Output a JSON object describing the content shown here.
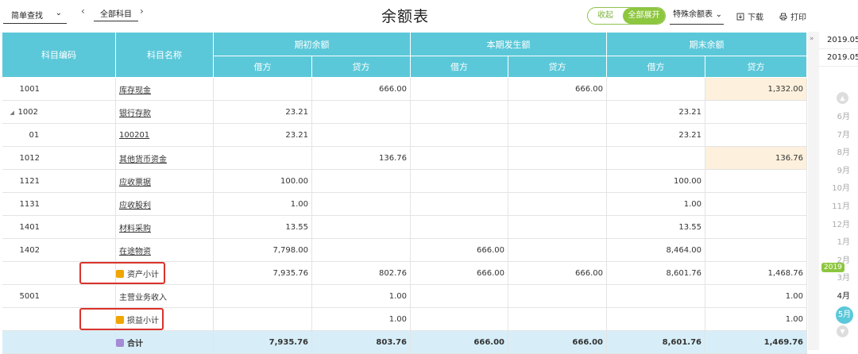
{
  "toolbar": {
    "simple_search": "简单查找",
    "all_subjects": "全部科目",
    "title": "余额表",
    "collapse": "收起",
    "expand_all": "全部展开",
    "special_table": "特殊余额表",
    "download": "下载",
    "print": "打印"
  },
  "table": {
    "col_code": "科目编码",
    "col_name": "科目名称",
    "group_opening": "期初余额",
    "group_current": "本期发生额",
    "group_closing": "期末余额",
    "debit": "借方",
    "credit": "贷方",
    "rows": [
      {
        "code": "1001",
        "name": "库存现金",
        "open_d": "",
        "open_c": "666.00",
        "cur_d": "",
        "cur_c": "666.00",
        "close_d": "",
        "close_c": "1,332.00"
      },
      {
        "code": "1002",
        "name": "银行存款",
        "open_d": "23.21",
        "open_c": "",
        "cur_d": "",
        "cur_c": "",
        "close_d": "23.21",
        "close_c": ""
      },
      {
        "code": "01",
        "name": "100201",
        "open_d": "23.21",
        "open_c": "",
        "cur_d": "",
        "cur_c": "",
        "close_d": "23.21",
        "close_c": ""
      },
      {
        "code": "1012",
        "name": "其他货币资金",
        "open_d": "",
        "open_c": "136.76",
        "cur_d": "",
        "cur_c": "",
        "close_d": "",
        "close_c": "136.76"
      },
      {
        "code": "1121",
        "name": "应收票据",
        "open_d": "100.00",
        "open_c": "",
        "cur_d": "",
        "cur_c": "",
        "close_d": "100.00",
        "close_c": ""
      },
      {
        "code": "1131",
        "name": "应收股利",
        "open_d": "1.00",
        "open_c": "",
        "cur_d": "",
        "cur_c": "",
        "close_d": "1.00",
        "close_c": ""
      },
      {
        "code": "1401",
        "name": "材料采购",
        "open_d": "13.55",
        "open_c": "",
        "cur_d": "",
        "cur_c": "",
        "close_d": "13.55",
        "close_c": ""
      },
      {
        "code": "1402",
        "name": "在途物资",
        "open_d": "7,798.00",
        "open_c": "",
        "cur_d": "666.00",
        "cur_c": "",
        "close_d": "8,464.00",
        "close_c": ""
      },
      {
        "code": "",
        "name": "资产小计",
        "open_d": "7,935.76",
        "open_c": "802.76",
        "cur_d": "666.00",
        "cur_c": "666.00",
        "close_d": "8,601.76",
        "close_c": "1,468.76"
      },
      {
        "code": "5001",
        "name": "主营业务收入",
        "open_d": "",
        "open_c": "1.00",
        "cur_d": "",
        "cur_c": "",
        "close_d": "",
        "close_c": "1.00"
      },
      {
        "code": "",
        "name": "损益小计",
        "open_d": "",
        "open_c": "1.00",
        "cur_d": "",
        "cur_c": "",
        "close_d": "",
        "close_c": "1.00"
      },
      {
        "code": "",
        "name": "合计",
        "open_d": "7,935.76",
        "open_c": "803.76",
        "cur_d": "666.00",
        "cur_c": "666.00",
        "close_d": "8,601.76",
        "close_c": "1,469.76"
      }
    ]
  },
  "side": {
    "date_from": "2019.05",
    "date_to": "2019.05",
    "year_badge": "2019",
    "months": [
      "6月",
      "7月",
      "8月",
      "9月",
      "10月",
      "11月",
      "12月",
      "1月",
      "2月",
      "3月",
      "4月",
      "5月"
    ]
  },
  "colors": {
    "header": "#5bc8d9",
    "accent_green": "#8dc63f",
    "highlight": "#fdf0dc",
    "total_row": "#d7eef8",
    "annotation_red": "#d9342b"
  }
}
